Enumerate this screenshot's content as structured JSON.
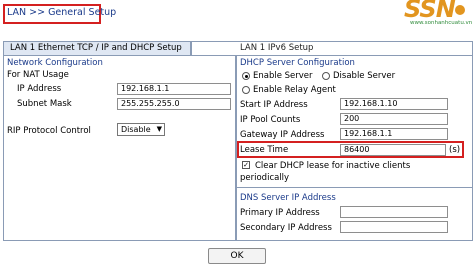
{
  "header": {
    "breadcrumb": "LAN >> General Setup"
  },
  "logo": {
    "mark": "SSN",
    "tagline": "www.sonhanhcuatu.vn"
  },
  "tabs": [
    {
      "label": "LAN 1 Ethernet TCP / IP and DHCP Setup",
      "active": true
    },
    {
      "label": "LAN 1 IPv6 Setup",
      "active": false
    }
  ],
  "network": {
    "title": "Network Configuration",
    "nat_label": "For NAT Usage",
    "ip_label": "IP Address",
    "ip_value": "192.168.1.1",
    "mask_label": "Subnet Mask",
    "mask_value": "255.255.255.0",
    "rip_label": "RIP Protocol Control",
    "rip_value": "Disable"
  },
  "dhcp": {
    "title": "DHCP Server Configuration",
    "enable_label": "Enable Server",
    "disable_label": "Disable Server",
    "selected": "Enable Server",
    "relay_label": "Enable Relay Agent",
    "start_label": "Start IP Address",
    "start_value": "192.168.1.10",
    "pool_label": "IP Pool Counts",
    "pool_value": "200",
    "gateway_label": "Gateway IP Address",
    "gateway_value": "192.168.1.1",
    "lease_label": "Lease Time",
    "lease_value": "86400",
    "lease_unit": "(s)",
    "clear_label_1": "Clear DHCP lease for inactive clients",
    "clear_label_2": "periodically",
    "clear_checked": true
  },
  "dns": {
    "title": "DNS Server IP Address",
    "primary_label": "Primary IP Address",
    "primary_value": "",
    "secondary_label": "Secondary IP Address",
    "secondary_value": ""
  },
  "footer": {
    "ok_label": "OK"
  },
  "colors": {
    "highlight": "#d42020",
    "section_title": "#1a3a8a",
    "tab_active_bg": "#dfe7f3",
    "logo": "#e2951f"
  }
}
